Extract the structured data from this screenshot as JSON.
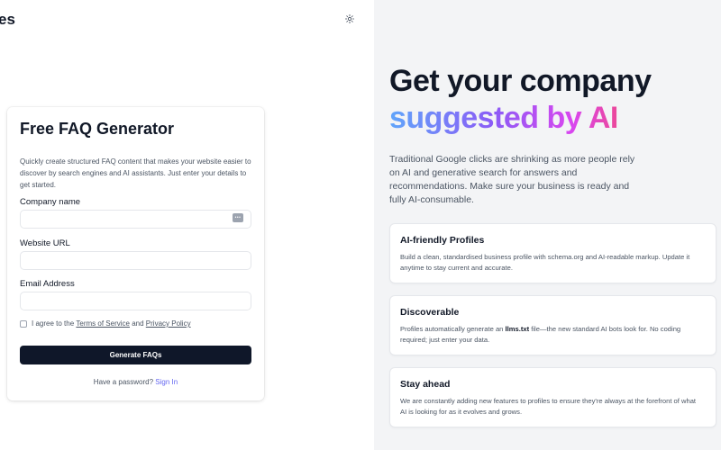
{
  "header": {
    "logo_fragment": "es",
    "theme_toggle_icon": "sun-icon"
  },
  "form": {
    "title": "Free FAQ Generator",
    "description": "Quickly create structured FAQ content that makes your website easier to discover by search engines and AI assistants. Just enter your details to get started.",
    "company": {
      "label": "Company name",
      "value": "",
      "placeholder": ""
    },
    "website": {
      "label": "Website URL",
      "value": "",
      "placeholder": ""
    },
    "email": {
      "label": "Email Address",
      "value": "",
      "placeholder": ""
    },
    "password_manager_icon": "dots-icon",
    "agree": {
      "prefix": "I agree to the",
      "terms": "Terms of Service",
      "and": "and",
      "privacy": "Privacy Policy",
      "checked": false
    },
    "submit_label": "Generate FAQs",
    "signin": {
      "prompt": "Have a password?",
      "link": "Sign In"
    }
  },
  "hero": {
    "line1": "Get your company",
    "line2": "suggested by AI",
    "description": "Traditional Google clicks are shrinking as more people rely on AI and generative search for answers and recommendations. Make sure your business is ready and fully AI-consumable."
  },
  "features": [
    {
      "title": "AI-friendly Profiles",
      "description": "Build a clean, standardised business profile with schema.org and AI-readable markup. Update it anytime to stay current and accurate."
    },
    {
      "title": "Discoverable",
      "description_before": "Profiles automatically generate an",
      "description_bold": "llms.txt",
      "description_after": "file—the new standard AI bots look for. No coding required; just enter your data."
    },
    {
      "title": "Stay ahead",
      "description": "We are constantly adding new features to profiles to ensure they're always at the forefront of what AI is looking for as it evolves and grows."
    }
  ],
  "colors": {
    "primary_button": "#0f1729",
    "link_accent": "#6366f1",
    "gradient_start": "#60a5fa",
    "gradient_end": "#ec4899",
    "right_panel_bg": "#f3f4f6"
  }
}
